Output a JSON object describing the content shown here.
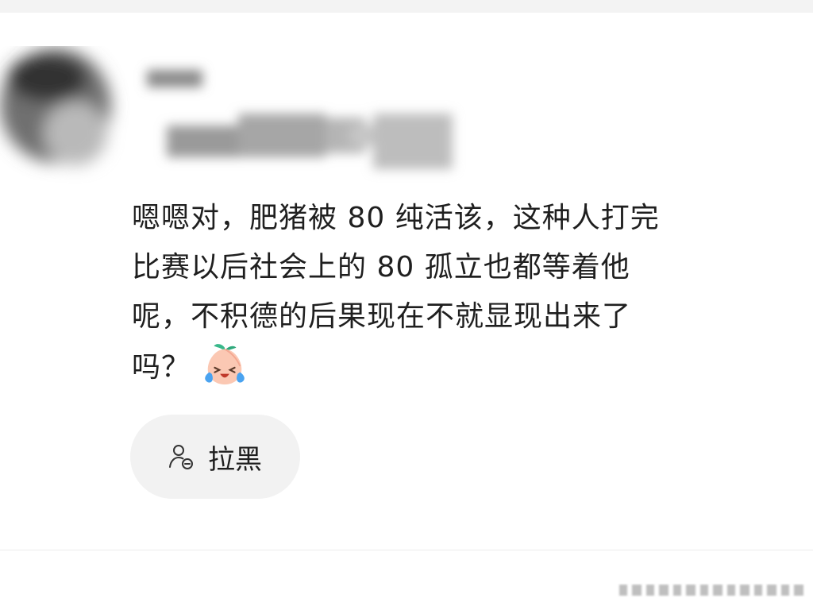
{
  "comment": {
    "lines": [
      "嗯嗯对，肥猪被 80 纯活该，这种人打完",
      "比赛以后社会上的 80 孤立也都等着他",
      "呢，不积德的后果现在不就显现出来了",
      "吗？"
    ],
    "emoji": "laughing-crying-peach-emoji"
  },
  "actions": {
    "block_label": "拉黑",
    "block_icon": "user-block-icon"
  },
  "colors": {
    "text": "#1f1f1f",
    "button_bg": "#f2f2f2",
    "divider": "#ececec"
  }
}
